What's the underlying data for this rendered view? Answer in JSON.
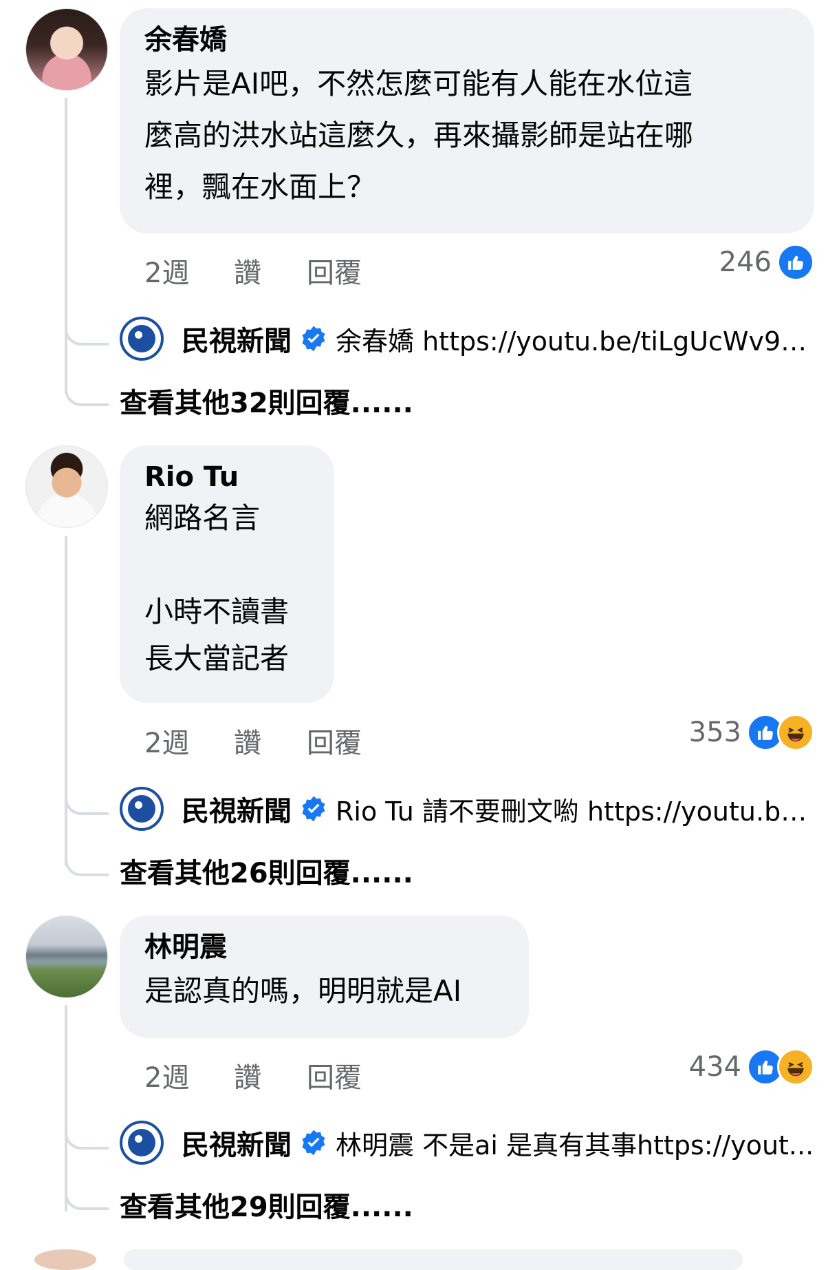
{
  "comments": [
    {
      "author": "余春嬌",
      "text": "影片是AI吧，不然怎麼可能有人能在水位這\n麼高的洪水站這麼久，再來攝影師是站在哪\n裡，飄在水面上？",
      "time": "2週",
      "like_label": "讚",
      "reply_label": "回覆",
      "reaction_count": "246",
      "reactions": [
        "like-icon"
      ],
      "page_reply": {
        "page_name": "民視新聞",
        "text": "余春嬌 https://youtu.be/tiLgUcWv9s0..."
      },
      "more_replies": "查看其他32則回覆......"
    },
    {
      "author": "Rio Tu",
      "text": "網路名言\n\n小時不讀書\n長大當記者",
      "time": "2週",
      "like_label": "讚",
      "reply_label": "回覆",
      "reaction_count": "353",
      "reactions": [
        "like-icon",
        "haha-icon"
      ],
      "page_reply": {
        "page_name": "民視新聞",
        "text": "Rio Tu 請不要刪文喲 https://youtu.be/..."
      },
      "more_replies": "查看其他26則回覆......"
    },
    {
      "author": "林明震",
      "text": "是認真的嗎，明明就是AI",
      "time": "2週",
      "like_label": "讚",
      "reply_label": "回覆",
      "reaction_count": "434",
      "reactions": [
        "like-icon",
        "haha-icon"
      ],
      "page_reply": {
        "page_name": "民視新聞",
        "text": "林明震 不是ai 是真有其事https://yout..."
      },
      "more_replies": "查看其他29則回覆......"
    }
  ],
  "colors": {
    "bubble": "#f0f2f5",
    "meta": "#65676b",
    "like": "#1877f2",
    "haha": "#f7b125",
    "page_logo": "#1c4fa0"
  }
}
